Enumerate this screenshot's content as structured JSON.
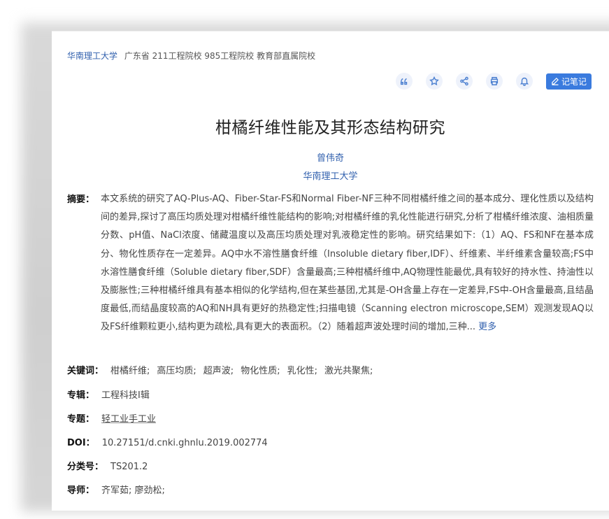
{
  "source": {
    "university": "华南理工大学",
    "tags": "广东省 211工程院校 985工程院校 教育部直属院校"
  },
  "toolbar": {
    "note_label": "记笔记"
  },
  "paper": {
    "title": "柑橘纤维性能及其形态结构研究",
    "author": "曾伟奇",
    "affiliation": "华南理工大学",
    "abstract_label": "摘要：",
    "abstract_text": "本文系统的研究了AQ-Plus-AQ、Fiber-Star-FS和Normal Fiber-NF三种不同柑橘纤维之间的基本成分、理化性质以及结构间的差异,探讨了高压均质处理对柑橘纤维性能结构的影响;对柑橘纤维的乳化性能进行研究,分析了柑橘纤维浓度、油相质量分数、pH值、NaCl浓度、储藏温度以及高压均质处理对乳液稳定性的影响。研究结果如下:（1）AQ、FS和NF在基本成分、物化性质存在一定差异。AQ中水不溶性膳食纤维（Insoluble dietary fiber,IDF）、纤维素、半纤维素含量较高;FS中水溶性膳食纤维（Soluble dietary fiber,SDF）含量最高;三种柑橘纤维中,AQ物理性能最优,具有较好的持水性、持油性以及膨胀性;三种柑橘纤维具有基本相似的化学结构,但在某些基团,尤其是-OH含量上存在一定差异,FS中-OH含量最高,且结晶度最低,而结晶度较高的AQ和NH具有更好的热稳定性;扫描电镜（Scanning electron microscope,SEM）观测发现AQ以及FS纤维颗粒更小,结构更为疏松,具有更大的表面积。（2）随着超声波处理时间的增加,三种...",
    "more_label": "更多",
    "keywords_label": "关键词：",
    "keywords": [
      "柑橘纤维;",
      "高压均质;",
      "超声波;",
      "物化性质;",
      "乳化性;",
      "激光共聚焦;"
    ],
    "series_label": "专辑：",
    "series_value": "工程科技Ⅰ辑",
    "topic_label": "专题：",
    "topic_value": "轻工业手工业",
    "doi_label": "DOI：",
    "doi_value": "10.27151/d.cnki.ghnlu.2019.002774",
    "class_label": "分类号：",
    "class_value": "TS201.2",
    "advisor_label": "导师：",
    "advisor_value": "齐军茹; 廖劲松;"
  },
  "colors": {
    "accent": "#3a7bde",
    "link": "#2f5fad",
    "icon_bg": "#eef2fb"
  },
  "icons": [
    "quote-icon",
    "star-icon",
    "share-icon",
    "print-icon",
    "bell-icon",
    "pen-icon"
  ]
}
